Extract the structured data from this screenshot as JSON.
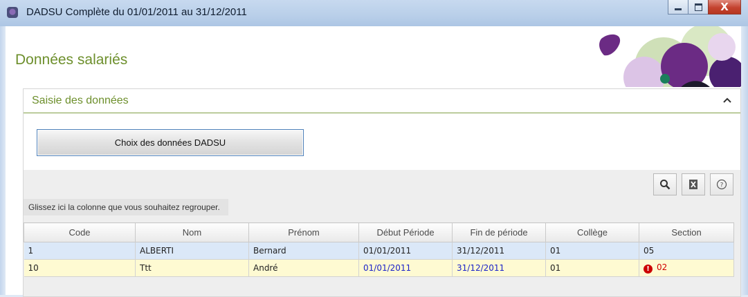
{
  "window": {
    "title": "DADSU Complète du 01/01/2011 au 31/12/2011",
    "minimize_icon": "minimize-icon",
    "maximize_icon": "maximize-icon",
    "close_glyph": "X"
  },
  "page": {
    "title": "Données salariés"
  },
  "section": {
    "title": "Saisie des données"
  },
  "choice_button": {
    "label": "Choix des données DADSU"
  },
  "grid": {
    "group_hint": "Glissez ici la colonne que vous souhaitez regrouper.",
    "columns": [
      "Code",
      "Nom",
      "Prénom",
      "Début Période",
      "Fin de période",
      "Collège",
      "Section"
    ],
    "rows": [
      {
        "code": "1",
        "nom": "ALBERTI",
        "prenom": "Bernard",
        "debut": "01/01/2011",
        "fin": "31/12/2011",
        "college": "01",
        "section": "05",
        "state": "selected"
      },
      {
        "code": "10",
        "nom": "Ttt",
        "prenom": "André",
        "debut": "01/01/2011",
        "fin": "31/12/2011",
        "college": "01",
        "section": "02",
        "state": "error"
      }
    ],
    "error_glyph": "!"
  },
  "colors": {
    "accent_green": "#6d8f2c",
    "error_red": "#cc0000",
    "date_blue": "#1a22c8",
    "row_selected": "#dbe8f8",
    "row_error": "#fefad2"
  }
}
